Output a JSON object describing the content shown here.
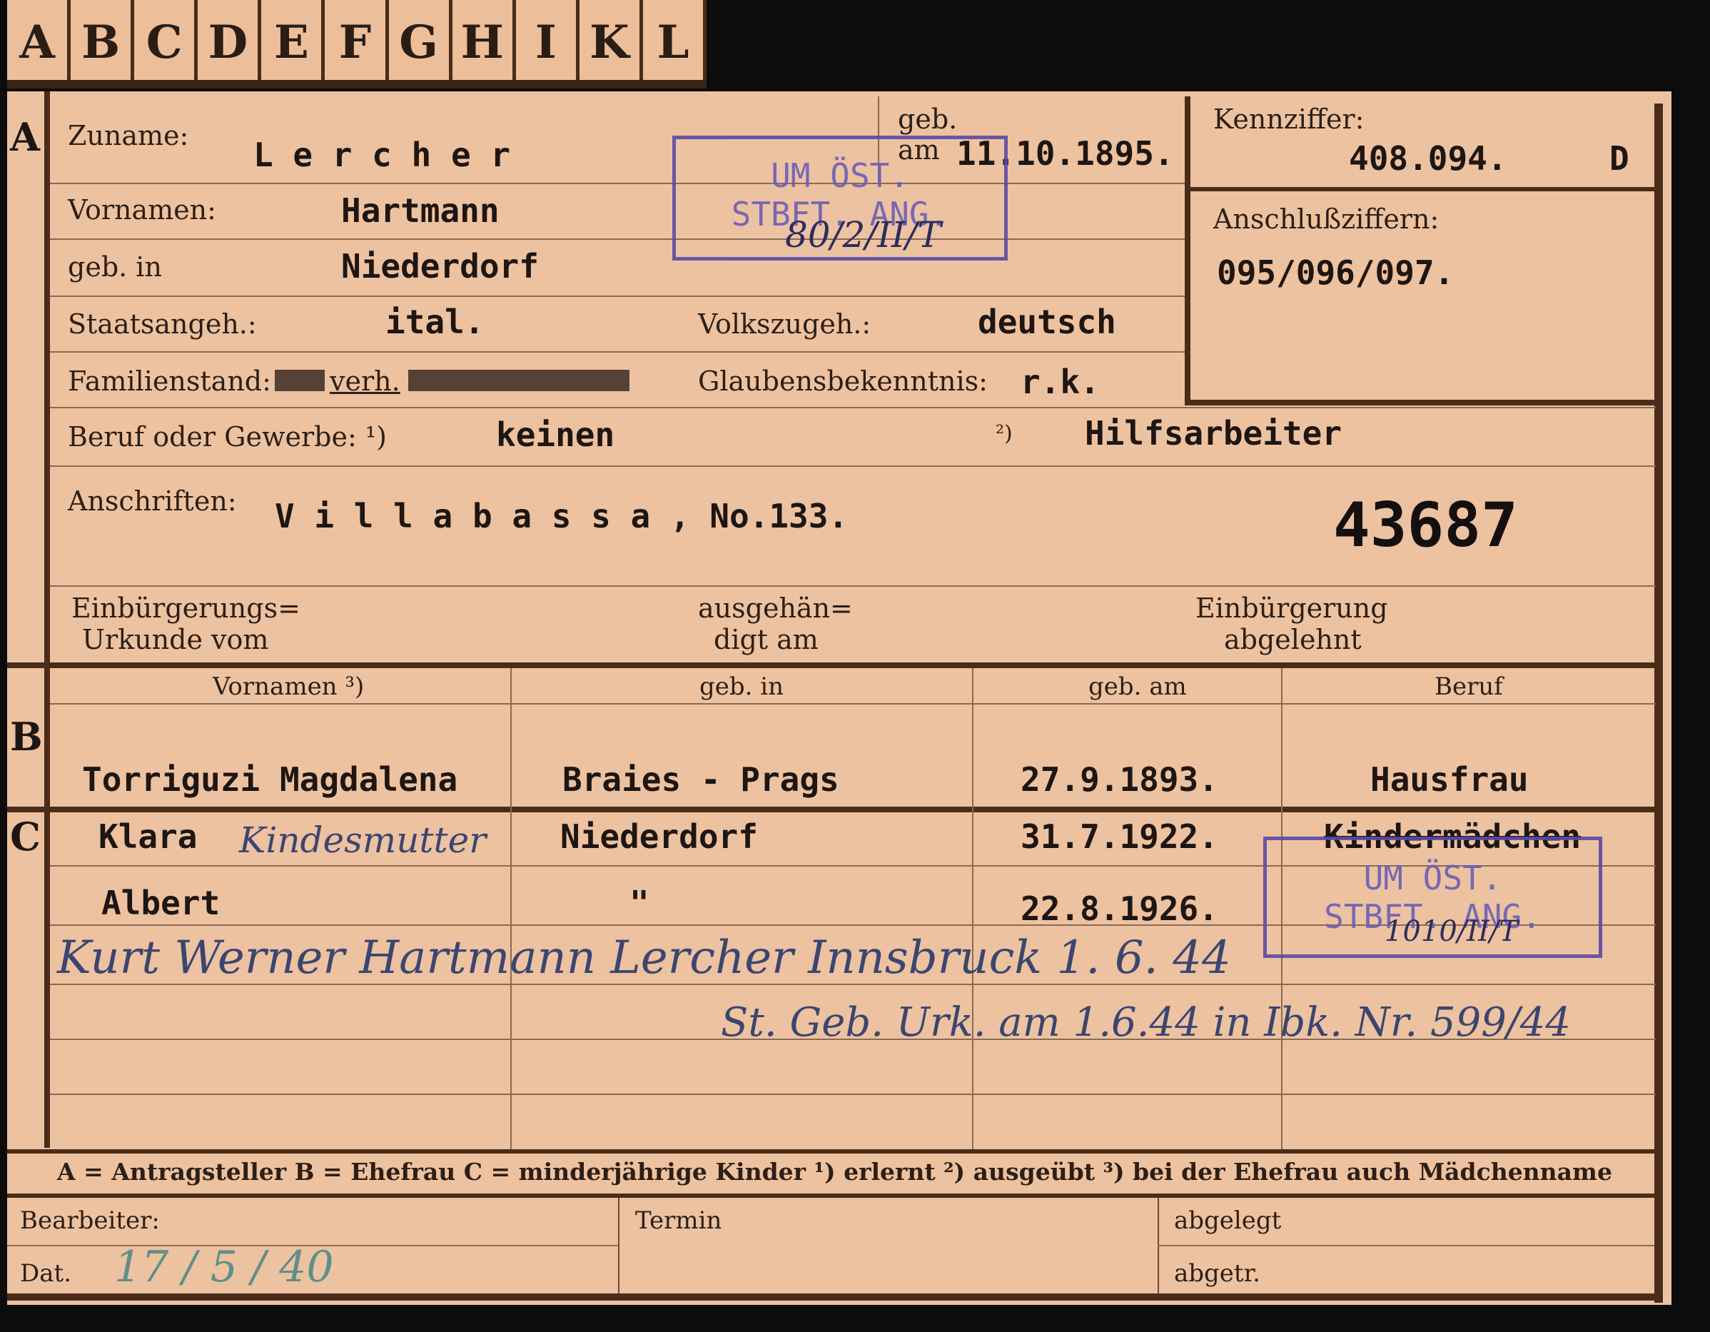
{
  "tabs": [
    "A",
    "B",
    "C",
    "D",
    "E",
    "F",
    "G",
    "H",
    "I",
    "K",
    "L"
  ],
  "section_letters": {
    "a": "A",
    "b": "B",
    "c": "C"
  },
  "applicant": {
    "surname_label": "Zuname:",
    "surname": "L e r c h e r",
    "birth_label_1": "geb.",
    "birth_label_2": "am",
    "birth_date": "11.10.1895.",
    "given_label": "Vornamen:",
    "given": "Hartmann",
    "birthplace_label": "geb. in",
    "birthplace": "Niederdorf",
    "citizenship_label": "Staatsangeh.:",
    "citizenship": "ital.",
    "ethnicity_label": "Volkszugeh.:",
    "ethnicity": "deutsch",
    "marital_label": "Familienstand:",
    "marital": "verh.",
    "religion_label": "Glaubensbekenntnis:",
    "religion": "r.k.",
    "profession_label": "Beruf oder Gewerbe: ¹)",
    "profession_learned": "keinen",
    "profession_practiced_mark": "²)",
    "profession_practiced": "Hilfsarbeiter",
    "address_label": "Anschriften:",
    "address": "V i l l a b a s s a ,  No.133.",
    "number": "43687",
    "naturalization_label_1": "Einbürgerungs=",
    "naturalization_label_2": "Urkunde vom",
    "handed_label_1": "ausgehän=",
    "handed_label_2": "digt am",
    "rejected_label_1": "Einbürgerung",
    "rejected_label_2": "abgelehnt"
  },
  "reference": {
    "code_label": "Kennziffer:",
    "code": "408.094.",
    "code_suffix": "D",
    "connected_label": "Anschlußziffern:",
    "connected": "095/096/097."
  },
  "stamp_top": {
    "line1": "UM ÖST.",
    "line2": "STBFT. ANG.",
    "hand": "80/2/II/T"
  },
  "stamp_bottom": {
    "line1": "UM ÖST.",
    "line2": "STBFT. ANG.",
    "hand": "1010/II/T"
  },
  "spouse_headers": [
    "Vornamen ³)",
    "geb. in",
    "geb. am",
    "Beruf"
  ],
  "spouse": {
    "name": "Torriguzi Magdalena",
    "place": "Braies - Prags",
    "date": "27.9.1893.",
    "job": "Hausfrau"
  },
  "children": [
    {
      "name": "Klara",
      "note": "Kindesmutter",
      "place": "Niederdorf",
      "date": "31.7.1922.",
      "job": "Kindermädchen"
    },
    {
      "name": "Albert",
      "place": "\"",
      "date": "22.8.1926."
    }
  ],
  "handwritten_child": "Kurt Werner Hartmann Lercher Innsbruck 1. 6. 44",
  "handwritten_cert": "St. Geb. Urk. am 1.6.44 in Ibk. Nr. 599/44",
  "legend": "A = Antragsteller   B = Ehefrau   C = minderjährige Kinder   ¹) erlernt   ²) ausgeübt   ³) bei der Ehefrau auch Mädchenname",
  "footer": {
    "clerk_label": "Bearbeiter:",
    "date_label": "Dat.",
    "date_value": "17 / 5 / 40",
    "deadline_label": "Termin",
    "filed_label": "abgelegt",
    "removed_label": "abgetr."
  }
}
